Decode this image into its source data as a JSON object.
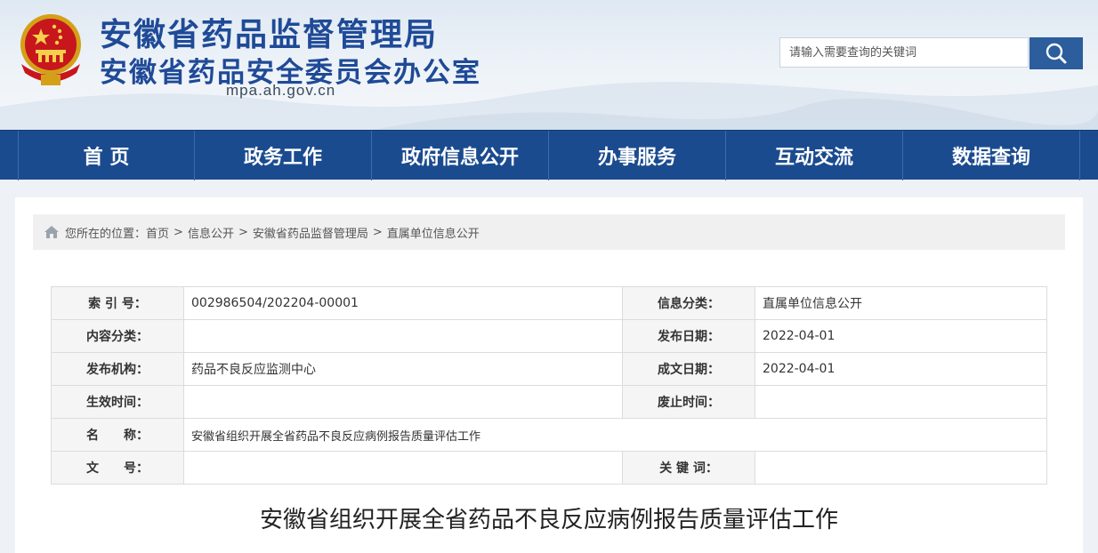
{
  "header": {
    "title_line1": "安徽省药品监督管理局",
    "title_line2": "安徽省药品安全委员会办公室",
    "domain": "mpa.ah.gov.cn",
    "colors": {
      "title": "#1f4a97",
      "nav_bg": "#1b4b8f",
      "search_btn": "#2c5d9d"
    }
  },
  "search": {
    "placeholder": "请输入需要查询的关键词",
    "icon": "search-icon"
  },
  "nav": {
    "items": [
      {
        "label": "首 页"
      },
      {
        "label": "政务工作"
      },
      {
        "label": "政府信息公开"
      },
      {
        "label": "办事服务"
      },
      {
        "label": "互动交流"
      },
      {
        "label": "数据查询"
      }
    ]
  },
  "breadcrumb": {
    "prefix": "您所在的位置：",
    "links": [
      "首页",
      "信息公开",
      "安徽省药品监督管理局",
      "直属单位信息公开"
    ],
    "separator": ">",
    "icon": "home-icon"
  },
  "meta": {
    "index_label": "索 引 号：",
    "index_value": "002986504/202204-00001",
    "category_label": "信息分类：",
    "category_value": "直属单位信息公开",
    "content_type_label": "内容分类：",
    "content_type_value": "",
    "publish_date_label": "发布日期：",
    "publish_date_value": "2022-04-01",
    "publisher_label": "发布机构：",
    "publisher_value": "药品不良反应监测中心",
    "written_date_label": "成文日期：",
    "written_date_value": "2022-04-01",
    "effective_label": "生效时间：",
    "effective_value": "",
    "expire_label": "废止时间：",
    "expire_value": "",
    "name_label": "名　　称：",
    "name_value": "安徽省组织开展全省药品不良反应病例报告质量评估工作",
    "doc_no_label": "文　　号：",
    "doc_no_value": "",
    "keywords_label": "关 键 词：",
    "keywords_value": ""
  },
  "article": {
    "title": "安徽省组织开展全省药品不良反应病例报告质量评估工作"
  }
}
